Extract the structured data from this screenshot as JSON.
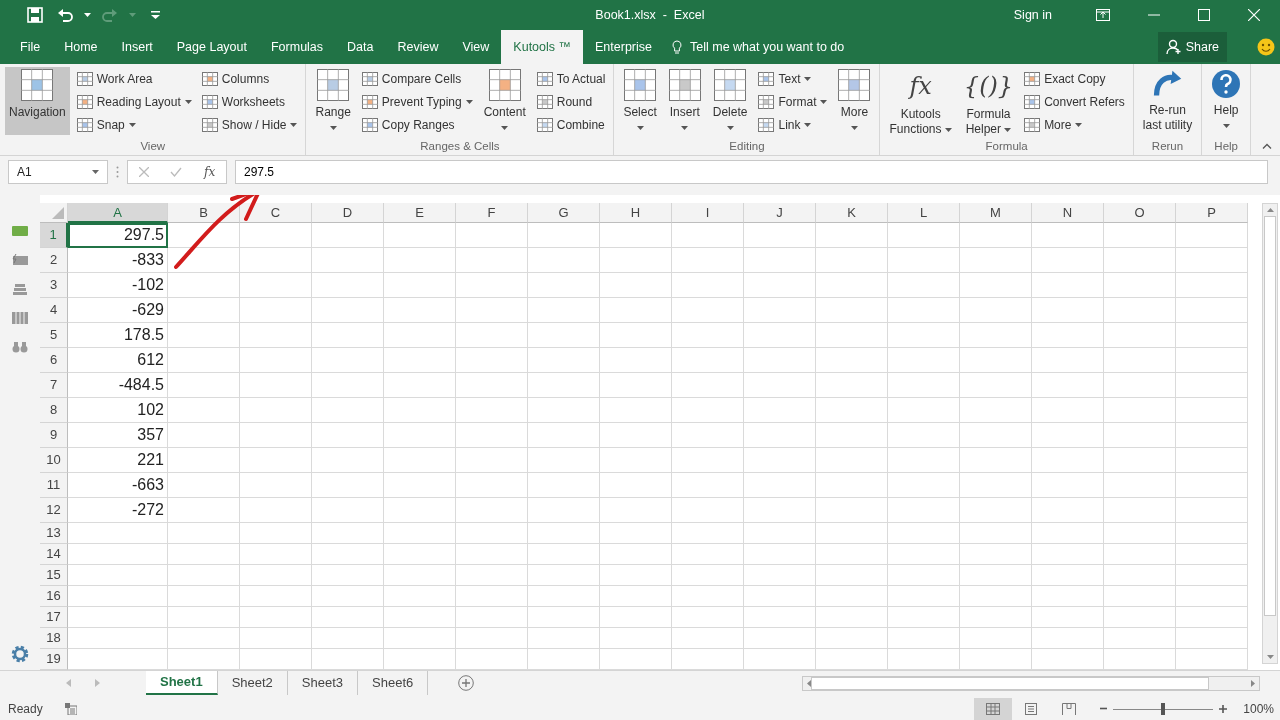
{
  "title_bar": {
    "title": "Book1.xlsx  -  Excel",
    "sign_in": "Sign in",
    "quick_access": [
      {
        "kind": "save",
        "disabled": false
      },
      {
        "kind": "undo",
        "disabled": false
      },
      {
        "kind": "redo",
        "disabled": true
      },
      {
        "kind": "customize",
        "disabled": false
      }
    ]
  },
  "tabs": [
    {
      "label": "File",
      "selected": false
    },
    {
      "label": "Home",
      "selected": false
    },
    {
      "label": "Insert",
      "selected": false
    },
    {
      "label": "Page Layout",
      "selected": false
    },
    {
      "label": "Formulas",
      "selected": false
    },
    {
      "label": "Data",
      "selected": false
    },
    {
      "label": "Review",
      "selected": false
    },
    {
      "label": "View",
      "selected": false
    },
    {
      "label": "Kutools ™",
      "selected": true
    },
    {
      "label": "Enterprise",
      "selected": false
    }
  ],
  "tell_me": "Tell me what you want to do",
  "share": "Share",
  "ribbon": [
    {
      "label": "View",
      "items": [
        {
          "kind": "large",
          "lines": [
            "Navigation"
          ],
          "selected": true,
          "dropdown": false
        },
        {
          "kind": "stack",
          "items": [
            {
              "label": "Work Area",
              "dropdown": false
            },
            {
              "label": "Reading Layout",
              "dropdown": true
            },
            {
              "label": "Snap",
              "dropdown": true
            }
          ]
        },
        {
          "kind": "stack",
          "items": [
            {
              "label": "Columns",
              "dropdown": false
            },
            {
              "label": "Worksheets",
              "dropdown": false
            },
            {
              "label": "Show / Hide",
              "dropdown": true
            }
          ]
        }
      ]
    },
    {
      "label": "Ranges & Cells",
      "items": [
        {
          "kind": "large",
          "lines": [
            "Range"
          ],
          "selected": false,
          "dropdown": true
        },
        {
          "kind": "stack",
          "items": [
            {
              "label": "Compare Cells",
              "dropdown": false
            },
            {
              "label": "Prevent Typing",
              "dropdown": true
            },
            {
              "label": "Copy Ranges",
              "dropdown": false
            }
          ]
        },
        {
          "kind": "large",
          "lines": [
            "Content"
          ],
          "selected": false,
          "dropdown": true
        },
        {
          "kind": "stack",
          "items": [
            {
              "label": "To Actual",
              "dropdown": false
            },
            {
              "label": "Round",
              "dropdown": false
            },
            {
              "label": "Combine",
              "dropdown": false
            }
          ]
        }
      ]
    },
    {
      "label": "Editing",
      "items": [
        {
          "kind": "large",
          "lines": [
            "Select"
          ],
          "selected": false,
          "dropdown": true
        },
        {
          "kind": "large",
          "lines": [
            "Insert"
          ],
          "selected": false,
          "dropdown": true
        },
        {
          "kind": "large",
          "lines": [
            "Delete"
          ],
          "selected": false,
          "dropdown": true
        },
        {
          "kind": "stack",
          "items": [
            {
              "label": "Text",
              "dropdown": true
            },
            {
              "label": "Format",
              "dropdown": true
            },
            {
              "label": "Link",
              "dropdown": true
            }
          ]
        },
        {
          "kind": "large",
          "lines": [
            "More"
          ],
          "selected": false,
          "dropdown": true
        }
      ]
    },
    {
      "label": "Formula",
      "items": [
        {
          "kind": "large",
          "glyph": "fx",
          "lines": [
            "Kutools",
            "Functions"
          ],
          "selected": false,
          "dropdown": true
        },
        {
          "kind": "large",
          "glyph": "{()}",
          "lines": [
            "Formula",
            "Helper"
          ],
          "selected": false,
          "dropdown": true
        },
        {
          "kind": "stack",
          "items": [
            {
              "label": "Exact Copy",
              "dropdown": false
            },
            {
              "label": "Convert Refers",
              "dropdown": false
            },
            {
              "label": "More",
              "dropdown": true
            }
          ]
        }
      ]
    },
    {
      "label": "Rerun",
      "items": [
        {
          "kind": "large",
          "lines": [
            "Re-run",
            "last utility"
          ],
          "selected": false,
          "dropdown": false
        }
      ]
    },
    {
      "label": "Help",
      "items": [
        {
          "kind": "large",
          "lines": [
            "Help"
          ],
          "selected": false,
          "dropdown": true
        }
      ]
    }
  ],
  "formula_bar": {
    "name_box": "A1",
    "insert_function": "fx",
    "formula": "297.5"
  },
  "columns": [
    {
      "label": "A",
      "selected": true
    },
    {
      "label": "B",
      "selected": false
    },
    {
      "label": "C",
      "selected": false
    },
    {
      "label": "D",
      "selected": false
    },
    {
      "label": "E",
      "selected": false
    },
    {
      "label": "F",
      "selected": false
    },
    {
      "label": "G",
      "selected": false
    },
    {
      "label": "H",
      "selected": false
    },
    {
      "label": "I",
      "selected": false
    },
    {
      "label": "J",
      "selected": false
    },
    {
      "label": "K",
      "selected": false
    },
    {
      "label": "L",
      "selected": false
    },
    {
      "label": "M",
      "selected": false
    },
    {
      "label": "N",
      "selected": false
    },
    {
      "label": "O",
      "selected": false
    },
    {
      "label": "P",
      "selected": false
    }
  ],
  "rows": [
    {
      "label": "1",
      "selected": true,
      "cells": [
        "297.5"
      ]
    },
    {
      "label": "2",
      "selected": false,
      "cells": [
        "-833"
      ]
    },
    {
      "label": "3",
      "selected": false,
      "cells": [
        "-102"
      ]
    },
    {
      "label": "4",
      "selected": false,
      "cells": [
        "-629"
      ]
    },
    {
      "label": "5",
      "selected": false,
      "cells": [
        "178.5"
      ]
    },
    {
      "label": "6",
      "selected": false,
      "cells": [
        "612"
      ]
    },
    {
      "label": "7",
      "selected": false,
      "cells": [
        "-484.5"
      ]
    },
    {
      "label": "8",
      "selected": false,
      "cells": [
        "102"
      ]
    },
    {
      "label": "9",
      "selected": false,
      "cells": [
        "357"
      ]
    },
    {
      "label": "10",
      "selected": false,
      "cells": [
        "221"
      ]
    },
    {
      "label": "11",
      "selected": false,
      "cells": [
        "-663"
      ]
    },
    {
      "label": "12",
      "selected": false,
      "cells": [
        "-272"
      ]
    },
    {
      "label": "13",
      "selected": false
    },
    {
      "label": "14",
      "selected": false
    },
    {
      "label": "15",
      "selected": false
    },
    {
      "label": "16",
      "selected": false
    },
    {
      "label": "17",
      "selected": false
    },
    {
      "label": "18",
      "selected": false
    },
    {
      "label": "19",
      "selected": false
    }
  ],
  "sheets": [
    {
      "label": "Sheet1",
      "selected": true
    },
    {
      "label": "Sheet2",
      "selected": false
    },
    {
      "label": "Sheet3",
      "selected": false
    },
    {
      "label": "Sheet6",
      "selected": false
    }
  ],
  "status_bar": {
    "status": "Ready",
    "views": [
      {
        "kind": "normal",
        "selected": true
      },
      {
        "kind": "page_layout",
        "selected": false
      },
      {
        "kind": "page_break",
        "selected": false
      }
    ],
    "zoom": {
      "level": 0.5,
      "reading": "100%"
    }
  }
}
